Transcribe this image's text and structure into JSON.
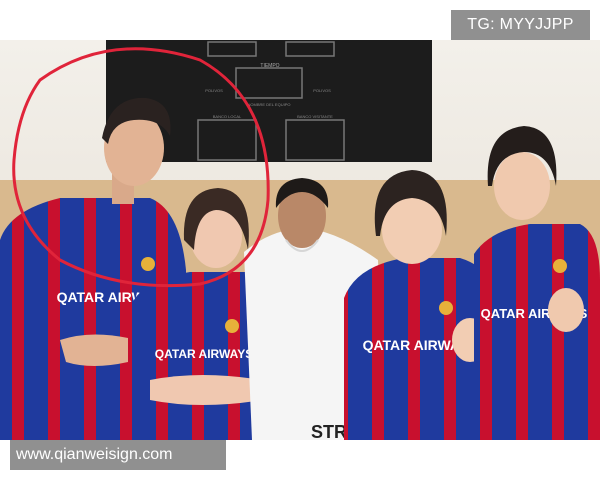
{
  "watermarks": {
    "top_right": "TG: MYYJJPP",
    "bottom_left": "www.qianweisign.com"
  },
  "photo": {
    "board_title": "TIEMPO",
    "board_small_labels": [
      "POLIVOS",
      "POLIVOS",
      "BANCO LOCAL",
      "BANCO VISITANTE",
      "NOMBRE DEL EQUIPO"
    ],
    "jersey_sponsor": "QATAR AIRWAYS",
    "shirt_text": "STRO",
    "colors": {
      "jersey_blue": "#1f3a9e",
      "jersey_red": "#c8102e",
      "wall": "#efeae2",
      "board": "#1c1c1c",
      "highlight_circle": "#e0243a"
    }
  }
}
